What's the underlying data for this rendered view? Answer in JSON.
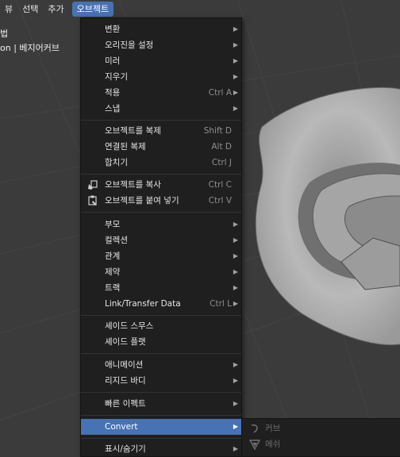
{
  "menubar": {
    "items": [
      "뷰",
      "선택",
      "추가",
      "오브젝트"
    ]
  },
  "overlay": {
    "line1": "법",
    "line2": "on | 베지어커브"
  },
  "menu": {
    "transform": "변환",
    "set_origin": "오리진을 설정",
    "mirror": "미러",
    "clear": "지우기",
    "apply": "적용",
    "apply_sc": "Ctrl A",
    "snap": "스냅",
    "duplicate": "오브젝트를 복제",
    "duplicate_sc": "Shift D",
    "linked_dup": "연결된 복제",
    "linked_dup_sc": "Alt D",
    "join": "합치기",
    "join_sc": "Ctrl J",
    "copy": "오브젝트를 복사",
    "copy_sc": "Ctrl C",
    "paste": "오브젝트를 붙여 넣기",
    "paste_sc": "Ctrl V",
    "parent": "부모",
    "collection": "컬렉션",
    "relations": "관계",
    "constraint": "제약",
    "track": "트랙",
    "link_transfer": "Link/Transfer Data",
    "link_transfer_sc": "Ctrl L",
    "shade_smooth": "셰이드 스무스",
    "shade_flat": "셰이드 플랫",
    "animation": "애니메이션",
    "rigid_body": "리지드 바디",
    "quick_effects": "빠른 이펙트",
    "convert": "Convert",
    "show_hide": "표시/숨기기"
  },
  "submenu": {
    "curve": "커브",
    "mesh": "메쉬"
  },
  "colors": {
    "accent": "#4772b3",
    "menu_bg": "#1f1f1f",
    "viewport_bg": "#3b3b3b"
  }
}
